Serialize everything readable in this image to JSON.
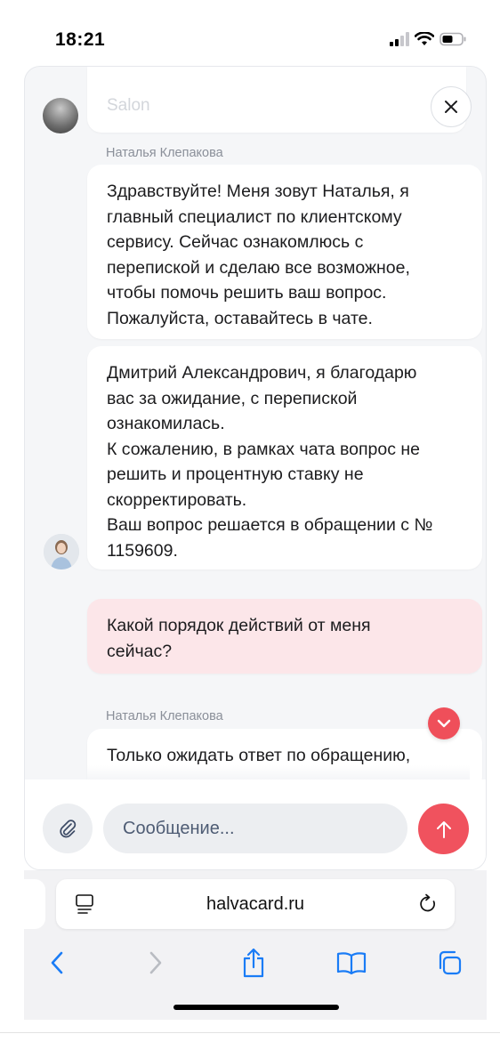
{
  "status_bar": {
    "time": "18:21"
  },
  "chat": {
    "agent_name": "Наталья Клепакова",
    "messages": [
      {
        "lines": [
          "Здравствуйте! Меня зовут Наталья, я",
          "главный специалист по клиентскому",
          "сервису. Сейчас ознакомлюсь с",
          "перепиской и сделаю все возможное,",
          "чтобы помочь решить ваш вопрос.",
          "Пожалуйста, оставайтесь в чате."
        ]
      },
      {
        "lines": [
          "Дмитрий Александрович, я благодарю",
          "вас за ожидание, с перепиской",
          "ознакомилась.",
          "К сожалению, в рамках чата вопрос не",
          "решить и процентную ставку не",
          "скорректировать.",
          "Ваш вопрос решается в обращении с №",
          "1159609."
        ]
      },
      {
        "lines": [
          "Какой порядок действий от меня",
          "сейчас?"
        ]
      },
      {
        "lines": [
          "Только ожидать ответ по обращению,"
        ]
      }
    ],
    "composer": {
      "placeholder": "Сообщение..."
    }
  },
  "browser": {
    "url": "halvacard.ru"
  },
  "colors": {
    "accent": "#f0525e",
    "user_bubble": "#fce6e9",
    "chat_bg": "#f5f6f8"
  },
  "icons": [
    "close-icon",
    "attach-icon",
    "send-icon",
    "chevron-down-icon",
    "reader-icon",
    "reload-icon",
    "back-icon",
    "forward-icon",
    "share-icon",
    "bookmarks-icon",
    "tabs-icon"
  ]
}
